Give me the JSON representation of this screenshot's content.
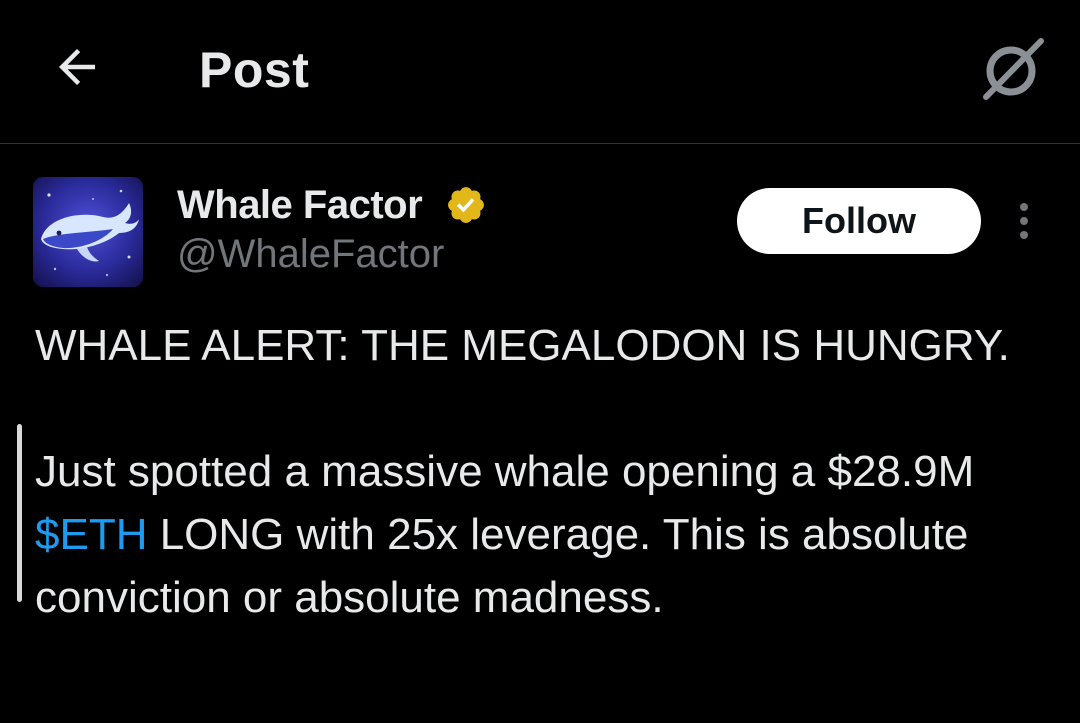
{
  "header": {
    "title": "Post",
    "back_icon": "arrow-left-icon",
    "grok_icon": "grok-icon"
  },
  "author": {
    "display_name": "Whale Factor",
    "handle": "@WhaleFactor",
    "verified": true,
    "verified_color": "#e2b719",
    "avatar_icon": "whale-avatar"
  },
  "actions": {
    "follow_label": "Follow",
    "more_icon": "more-vertical-icon"
  },
  "post": {
    "line1": "WHALE ALERT: THE MEGALODON IS HUNGRY.",
    "para2_before": "Just spotted a massive whale opening a $28.9M ",
    "cashtag": "$ETH",
    "para2_after": " LONG with 25x leverage. This is absolute conviction or absolute madness."
  },
  "colors": {
    "background": "#000000",
    "text": "#e7e9ea",
    "secondary_text": "#71767b",
    "link": "#1d9bf0"
  }
}
